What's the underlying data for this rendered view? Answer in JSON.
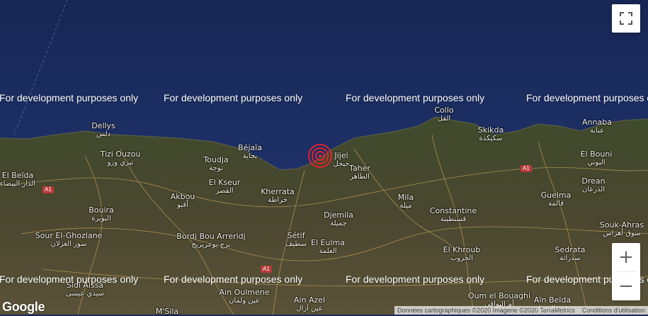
{
  "watermark": "For development purposes only",
  "places": [
    {
      "name": "Dellys",
      "ar": "دلس"
    },
    {
      "name": "Tizi Ouzou",
      "ar": "تيزي وزو"
    },
    {
      "name": "Béjaïa",
      "ar": "بجاية"
    },
    {
      "name": "Toudja",
      "ar": "توجة"
    },
    {
      "name": "Jijel",
      "ar": "جيجل"
    },
    {
      "name": "Taher",
      "ar": "الطاهر"
    },
    {
      "name": "Collo",
      "ar": "القل"
    },
    {
      "name": "Skikda",
      "ar": "سكيكدة"
    },
    {
      "name": "Annaba",
      "ar": "عنابة"
    },
    {
      "name": "El Bouni",
      "ar": "البوني"
    },
    {
      "name": "Drean",
      "ar": "الذرعان"
    },
    {
      "name": "Guelma",
      "ar": "قالمة"
    },
    {
      "name": "Souk-Ahras",
      "ar": "سوق أهراس"
    },
    {
      "name": "Sedrata",
      "ar": "سدراتة"
    },
    {
      "name": "El Khroub",
      "ar": "الخروب"
    },
    {
      "name": "Constantine",
      "ar": "قسنطينة"
    },
    {
      "name": "Mila",
      "ar": "ميلة"
    },
    {
      "name": "Djemila",
      "ar": "جميلة"
    },
    {
      "name": "El Eulma",
      "ar": "العلمة"
    },
    {
      "name": "Sétif",
      "ar": "سطيف"
    },
    {
      "name": "Kherrata",
      "ar": "خراطة"
    },
    {
      "name": "El Kseur",
      "ar": "القصر"
    },
    {
      "name": "Akbou",
      "ar": "أقبو"
    },
    {
      "name": "Bouira",
      "ar": "البويرة"
    },
    {
      "name": "Sour El-Ghozlane",
      "ar": "سور الغزلان"
    },
    {
      "name": "Bordj Bou Arreridj",
      "ar": "برج بوعريريج"
    },
    {
      "name": "Ain Oulmene",
      "ar": "عين ولمان"
    },
    {
      "name": "Ain Azel",
      "ar": "عين آزال"
    },
    {
      "name": "Sidi Aissa",
      "ar": "سيدي عيسى"
    },
    {
      "name": "Oum el Bouaghi",
      "ar": "أم البواقي"
    },
    {
      "name": "Aïn Beïda",
      "ar": "عين البيضاء"
    },
    {
      "name": "M'Sila",
      "ar": ""
    },
    {
      "name": "El Beïda",
      "ar": "الدار البيضاء"
    }
  ],
  "road_shields": [
    "A1",
    "A1",
    "A1"
  ],
  "controls": {
    "fullscreen_icon": "fullscreen-icon",
    "zoom_in": "+",
    "zoom_out": "−"
  },
  "branding": {
    "logo": "Google"
  },
  "attribution": {
    "data": "Données cartographiques ©2020 Imagerie ©2020 TerraMetrics",
    "terms": "Conditions d'utilisation"
  },
  "colors": {
    "sea": "#1b2a5c",
    "land": "#3a3f2a",
    "marker": "#e0232e"
  }
}
